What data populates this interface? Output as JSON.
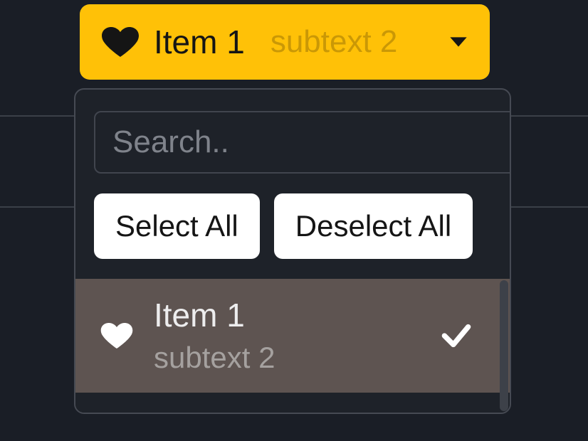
{
  "select": {
    "icon": "heart",
    "label": "Item 1",
    "subtext": "subtext 2"
  },
  "dropdown": {
    "search_placeholder": "Search..",
    "select_all_label": "Select All",
    "deselect_all_label": "Deselect All",
    "options": [
      {
        "icon": "heart",
        "label": "Item 1",
        "subtext": "subtext 2",
        "selected": true
      }
    ]
  },
  "colors": {
    "accent": "#ffc107",
    "bg": "#1a1e26",
    "panel": "#1e2229",
    "option_hover": "#5e5451",
    "danger": "#d9352e"
  }
}
